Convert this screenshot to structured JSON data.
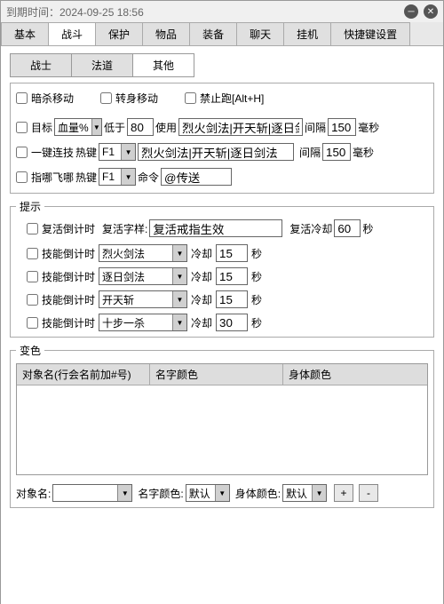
{
  "titlebar": {
    "expiry": "到期时间：2024-09-25 18:56"
  },
  "tabs": {
    "items": [
      "基本",
      "战斗",
      "保护",
      "物品",
      "装备",
      "聊天",
      "挂机",
      "快捷键设置"
    ],
    "activeIndex": 1
  },
  "subtabs": {
    "items": [
      "战士",
      "法道",
      "其他"
    ],
    "activeIndex": 2
  },
  "move": {
    "assassin": "暗杀移动",
    "turn": "转身移动",
    "norun": "禁止跑[Alt+H]"
  },
  "target": {
    "label": "目标",
    "metric": "血量%",
    "below": "低于",
    "threshold": "80",
    "use": "使用",
    "skills": "烈火剑法|开天斩|逐日剑法",
    "interval": "间隔",
    "intervalVal": "150",
    "ms": "毫秒"
  },
  "combo": {
    "label": "一键连技",
    "hotkey": "热键",
    "hotkeyVal": "F1",
    "skills": "烈火剑法|开天斩|逐日剑法",
    "interval": "间隔",
    "intervalVal": "150",
    "ms": "毫秒"
  },
  "fly": {
    "label": "指哪飞哪",
    "hotkey": "热键",
    "hotkeyVal": "F1",
    "cmd": "命令",
    "cmdVal": "@传送"
  },
  "hints": {
    "legend": "提示",
    "revive": {
      "enable": "复活倒计时",
      "textLabel": "复活字样:",
      "text": "复活戒指生效",
      "cdLabel": "复活冷却",
      "cd": "60",
      "sec": "秒"
    },
    "skills": {
      "label": "技能倒计时",
      "cdLabel": "冷却",
      "sec": "秒",
      "items": [
        {
          "name": "烈火剑法",
          "cd": "15"
        },
        {
          "name": "逐日剑法",
          "cd": "15"
        },
        {
          "name": "开天斩",
          "cd": "15"
        },
        {
          "name": "十步一杀",
          "cd": "30"
        }
      ]
    }
  },
  "colors": {
    "legend": "变色",
    "head": {
      "name": "对象名(行会名前加#号)",
      "nameColor": "名字颜色",
      "bodyColor": "身体颜色"
    },
    "footer": {
      "nameLabel": "对象名:",
      "nameColLabel": "名字颜色:",
      "bodyColLabel": "身体颜色:",
      "default": "默认",
      "add": "+",
      "del": "-"
    }
  }
}
